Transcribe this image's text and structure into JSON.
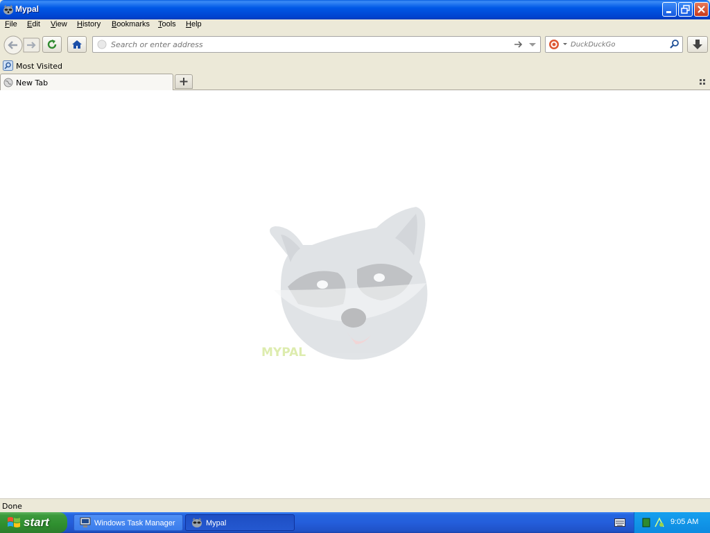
{
  "window": {
    "title": "Mypal"
  },
  "menu": [
    {
      "label": "File",
      "key": "F",
      "rest": "ile"
    },
    {
      "label": "Edit",
      "key": "E",
      "rest": "dit"
    },
    {
      "label": "View",
      "key": "V",
      "rest": "iew"
    },
    {
      "label": "History",
      "key": "H",
      "rest": "istory"
    },
    {
      "label": "Bookmarks",
      "key": "B",
      "rest": "ookmarks"
    },
    {
      "label": "Tools",
      "key": "T",
      "rest": "ools"
    },
    {
      "label": "Help",
      "key": "H",
      "rest": "elp"
    }
  ],
  "navbar": {
    "url_placeholder": "Search or enter address",
    "search_placeholder": "DuckDuckGo"
  },
  "bookmarks": {
    "most_visited": "Most Visited"
  },
  "tabs": [
    {
      "label": "New Tab"
    }
  ],
  "status": {
    "text": "Done"
  },
  "taskbar": {
    "start": "start",
    "tasks": [
      {
        "label": "Windows Task Manager"
      },
      {
        "label": "Mypal"
      }
    ],
    "clock": "9:05 AM"
  },
  "colors": {
    "titlebar": "#0058e6",
    "taskbar": "#245edb",
    "start": "#3c9a3c",
    "tray": "#0f94e8"
  },
  "logo": {
    "text": "MYPAL",
    "opacity": 0.28
  }
}
